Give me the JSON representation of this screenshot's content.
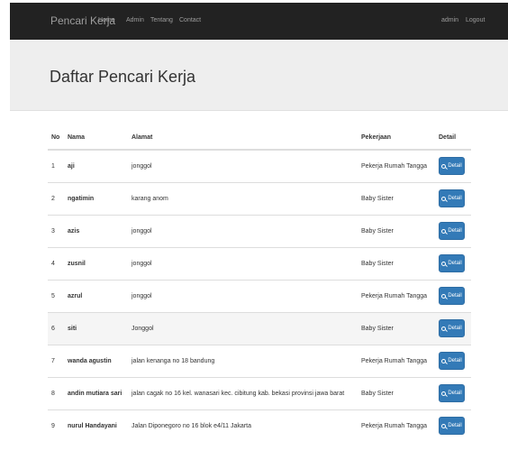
{
  "navbar": {
    "brand": "Pencari Kerja",
    "links": [
      "Home",
      "Admin",
      "Tentang",
      "Contact"
    ],
    "user": "admin",
    "logout": "Logout"
  },
  "header": {
    "title": "Daftar Pencari Kerja"
  },
  "table": {
    "headers": [
      "No",
      "Nama",
      "Alamat",
      "Pekerjaan",
      "Detail"
    ],
    "detail_label": "Detail",
    "rows": [
      {
        "no": "1",
        "nama": "aji",
        "alamat": "jonggol",
        "pekerjaan": "Pekerja Rumah Tangga"
      },
      {
        "no": "2",
        "nama": "ngatimin",
        "alamat": "karang anom",
        "pekerjaan": "Baby Sister"
      },
      {
        "no": "3",
        "nama": "azis",
        "alamat": "jonggol",
        "pekerjaan": "Baby Sister"
      },
      {
        "no": "4",
        "nama": "zusnil",
        "alamat": "jonggol",
        "pekerjaan": "Baby Sister"
      },
      {
        "no": "5",
        "nama": "azrul",
        "alamat": "jonggol",
        "pekerjaan": "Pekerja Rumah Tangga"
      },
      {
        "no": "6",
        "nama": "siti",
        "alamat": "Jonggol",
        "pekerjaan": "Baby Sister"
      },
      {
        "no": "7",
        "nama": "wanda agustin",
        "alamat": "jalan kenanga no 18 bandung",
        "pekerjaan": "Pekerja Rumah Tangga"
      },
      {
        "no": "8",
        "nama": "andin mutiara sari",
        "alamat": "jalan cagak no 16 kel. wanasari kec. cibitung kab. bekasi provinsi jawa barat",
        "pekerjaan": "Baby Sister"
      },
      {
        "no": "9",
        "nama": "nurul Handayani",
        "alamat": "Jalan Diponegoro no 16 blok e4/11 Jakarta",
        "pekerjaan": "Pekerja Rumah Tangga"
      }
    ]
  },
  "colors": {
    "navbar_bg": "#222222",
    "jumbotron_bg": "#eeeeee",
    "button_primary": "#337ab7"
  }
}
